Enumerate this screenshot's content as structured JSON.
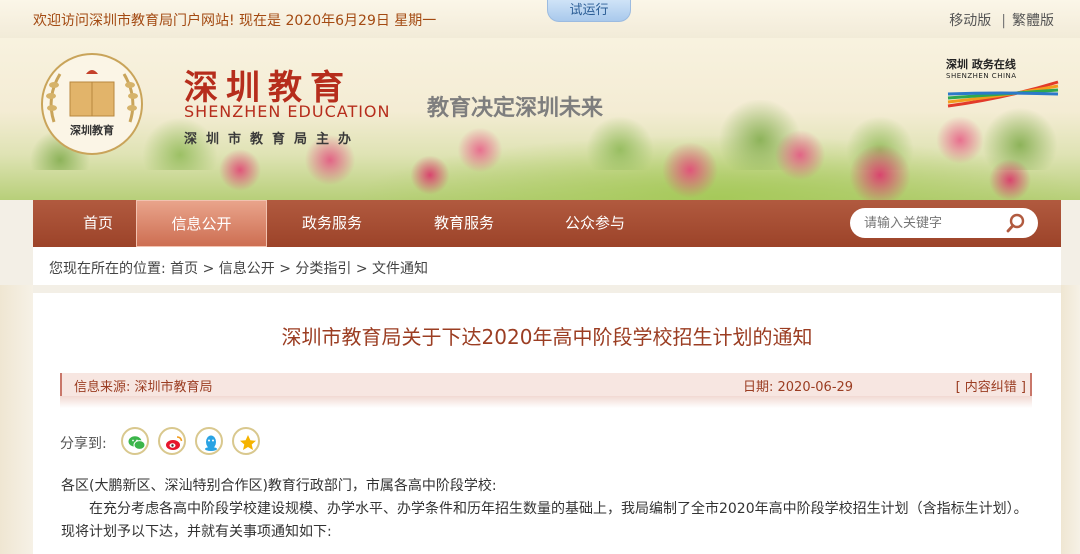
{
  "topbar": {
    "welcome": "欢迎访问深圳市教育局门户网站! 现在是 2020年6月29日 星期一",
    "trial": "试运行",
    "mobile": "移动版",
    "traditional": "繁體版"
  },
  "banner": {
    "brand_cn": "深圳教育",
    "brand_en": "SHENZHEN EDUCATION",
    "brand_sub": "深圳市教育局主办",
    "emblem_text": "深圳教育",
    "slogan": "教育决定深圳未来",
    "sz_logo_cn": "深圳 政务在线",
    "sz_logo_en": "SHENZHEN CHINA"
  },
  "nav": {
    "items": [
      {
        "label": "首页"
      },
      {
        "label": "信息公开"
      },
      {
        "label": "政务服务"
      },
      {
        "label": "教育服务"
      },
      {
        "label": "公众参与"
      }
    ],
    "active": "信息公开",
    "search_placeholder": "请输入关键字"
  },
  "breadcrumb": "您现在所在的位置: 首页 > 信息公开 > 分类指引 > 文件通知",
  "article": {
    "title": "深圳市教育局关于下达2020年高中阶段学校招生计划的通知",
    "source": "信息来源: 深圳市教育局",
    "date": "日期: 2020-06-29",
    "report_error": "[ 内容纠错 ]",
    "share_label": "分享到:",
    "share_targets": [
      "wechat-icon",
      "weibo-icon",
      "qq-icon",
      "qzone-icon"
    ],
    "salutation": "各区(大鹏新区、深汕特别合作区)教育行政部门，市属各高中阶段学校:",
    "paragraph1": "在充分考虑各高中阶段学校建设规模、办学水平、办学条件和历年招生数量的基础上，我局编制了全市2020年高中阶段学校招生计划（含指标生计划）。现将计划予以下达，并就有关事项通知如下:"
  },
  "colors": {
    "nav_bg": "#a44c31",
    "nav_active": "#d97c60",
    "title": "#9b3d22",
    "welcome": "#a34a12"
  }
}
